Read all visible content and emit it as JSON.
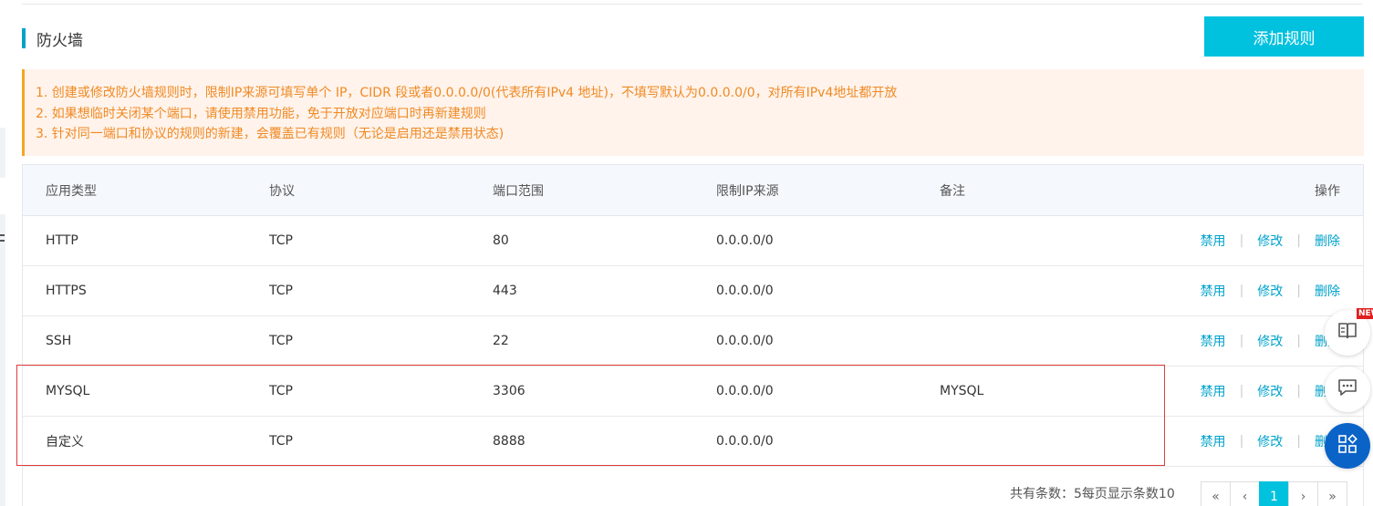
{
  "page": {
    "title": "防火墙",
    "add_button": "添加规则"
  },
  "notice": {
    "lines": [
      "1. 创建或修改防火墙规则时，限制IP来源可填写单个 IP，CIDR 段或者0.0.0.0/0(代表所有IPv4 地址)，不填写默认为0.0.0.0/0，对所有IPv4地址都开放",
      "2. 如果想临时关闭某个端口，请使用禁用功能，免于开放对应端口时再新建规则",
      "3. 针对同一端口和协议的规则的新建，会覆盖已有规则（无论是启用还是禁用状态)"
    ]
  },
  "table": {
    "headers": [
      "应用类型",
      "协议",
      "端口范围",
      "限制IP来源",
      "备注",
      "操作"
    ],
    "rows": [
      {
        "type": "HTTP",
        "protocol": "TCP",
        "port": "80",
        "source": "0.0.0.0/0",
        "note": ""
      },
      {
        "type": "HTTPS",
        "protocol": "TCP",
        "port": "443",
        "source": "0.0.0.0/0",
        "note": ""
      },
      {
        "type": "SSH",
        "protocol": "TCP",
        "port": "22",
        "source": "0.0.0.0/0",
        "note": ""
      },
      {
        "type": "MYSQL",
        "protocol": "TCP",
        "port": "3306",
        "source": "0.0.0.0/0",
        "note": "MYSQL"
      },
      {
        "type": "自定义",
        "protocol": "TCP",
        "port": "8888",
        "source": "0.0.0.0/0",
        "note": ""
      }
    ],
    "actions": {
      "disable": "禁用",
      "edit": "修改",
      "delete": "删除",
      "separator": "|"
    }
  },
  "pagination": {
    "summary": "共有条数：5每页显示条数10",
    "first": "«",
    "prev": "‹",
    "current": "1",
    "next": "›",
    "last": "»"
  },
  "float_panel": {
    "new_badge": "NEW",
    "icons": [
      "book-icon",
      "chat-icon",
      "apps-icon"
    ]
  },
  "colors": {
    "accent": "#00c1de",
    "link": "#00a2ca",
    "notice_text": "#f08a24",
    "highlight_border": "#e03c3c"
  }
}
